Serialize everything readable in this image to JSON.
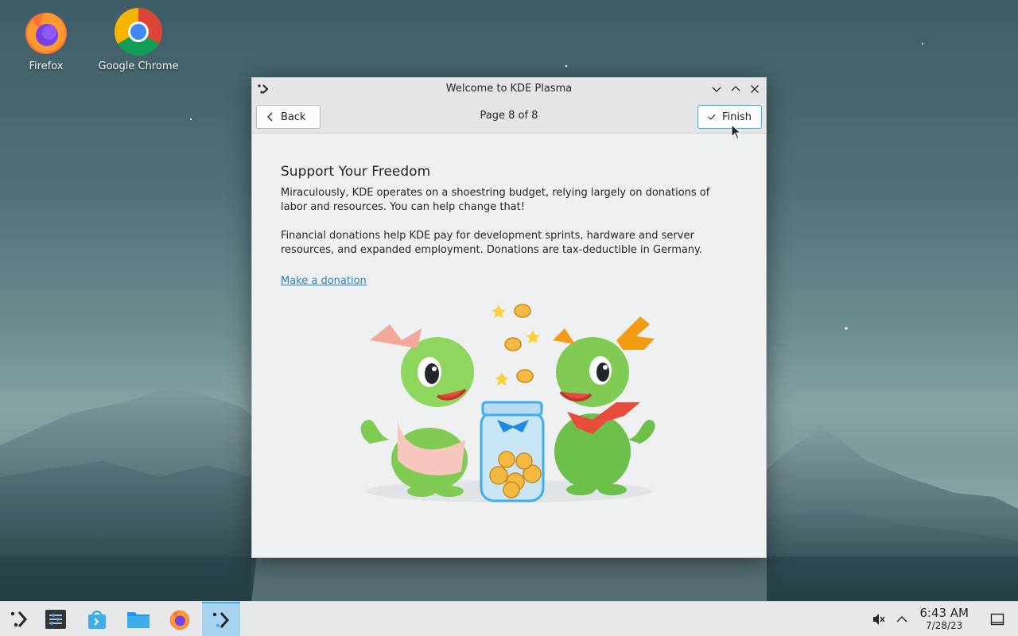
{
  "desktop": {
    "icons": [
      {
        "label": "Firefox",
        "icon": "firefox-icon"
      },
      {
        "label": "Google Chrome",
        "icon": "chrome-icon"
      }
    ]
  },
  "window": {
    "title": "Welcome to KDE Plasma",
    "toolbar": {
      "back_label": "Back",
      "page_label": "Page 8 of 8",
      "finish_label": "Finish"
    },
    "content": {
      "heading": "Support Your Freedom",
      "paragraph1": "Miraculously, KDE operates on a shoestring budget, relying largely on donations of labor and resources. You can help change that!",
      "paragraph2": "Financial donations help KDE pay for development sprints, hardware and server resources, and expanded employment. Donations are tax-deductible in Germany.",
      "link": "Make a donation"
    }
  },
  "taskbar": {
    "items": [
      "kde-launcher-icon",
      "system-settings-icon",
      "discover-icon",
      "dolphin-icon",
      "firefox-icon",
      "welcome-center-icon"
    ],
    "active_index": 5,
    "tray": [
      "volume-muted-icon",
      "chevron-up-icon",
      "show-desktop-icon"
    ],
    "clock": {
      "time": "6:43 AM",
      "date": "7/28/23"
    }
  },
  "colors": {
    "accent": "#3daee9",
    "link": "#2980b9",
    "window_bg": "#eff0f1",
    "taskbar_bg": "#e7e8ea"
  }
}
